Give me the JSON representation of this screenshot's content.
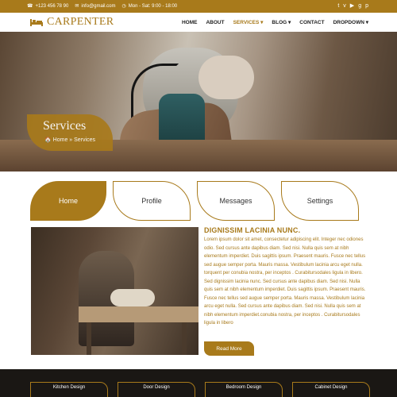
{
  "topbar": {
    "phone": "+123 456 78 90",
    "email": "info@gmail.com",
    "hours": "Mon - Sat: 9:00 - 18:00",
    "social_icons": [
      "twitter-icon",
      "vimeo-icon",
      "youtube-icon",
      "google-plus-icon",
      "pinterest-icon"
    ]
  },
  "brand": {
    "name": "CARPENTER",
    "color": "#a87a1b"
  },
  "nav": {
    "items": [
      {
        "label": "HOME"
      },
      {
        "label": "ABOUT"
      },
      {
        "label": "SERVICES ▾"
      },
      {
        "label": "BLOG ▾"
      },
      {
        "label": "CONTACT"
      },
      {
        "label": "DROPDOWN ▾"
      }
    ]
  },
  "hero": {
    "title": "Services",
    "breadcrumb": "🏠 Home » Services"
  },
  "tabs": [
    {
      "label": "Home"
    },
    {
      "label": "Profile"
    },
    {
      "label": "Messages"
    },
    {
      "label": "Settings"
    }
  ],
  "content": {
    "heading": "DIGNISSIM LACINIA NUNC.",
    "body": "Lorem ipsum dolor sit amet, consectetur adipiscing elit. Integer nec odiones odio. Sed cursus ante dapibus diam. Sed nisi. Nulla quis sem at nibh elementum imperdiet. Duis sagittis ipsum. Praesent mauris. Fusce nec tellus sed augue semper porta. Mauris massa. Vestibulum lacinia arcu eget nulla. torquent per conubia nostra, per inceptos . Curabitursodales ligula in libero. Sed dignissim lacinia nunc. Sed cursus ante dapibus diam. Sed nisi. Nulla quis sem at nibh elementum imperdiet. Duis sagittis ipsum. Praesent mauris. Fusce nec tellus sed augue semper porta. Mauris massa. Vestibulum lacinia arcu eget nulla. Sed cursus ante dapibus diam. Sed nisi. Nulla quis sem at nibh elementum imperdiet.conubia nostra, per inceptos . Curabitursodales ligula in libero",
    "read_more": "Read More"
  },
  "footer_buttons": [
    {
      "label": "Kitchen Design"
    },
    {
      "label": "Door Design"
    },
    {
      "label": "Bedroom Design"
    },
    {
      "label": "Cabinet Design"
    }
  ]
}
